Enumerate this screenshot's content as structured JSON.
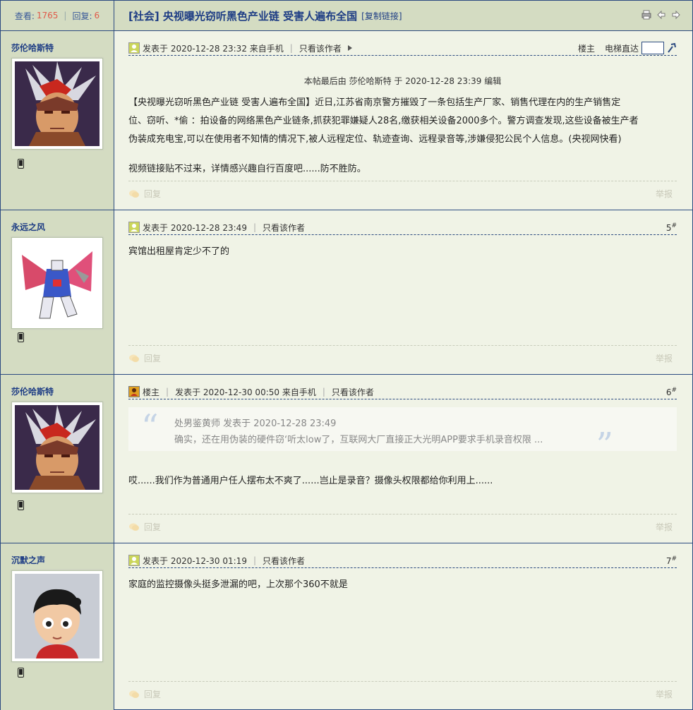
{
  "header": {
    "views_label": "查看:",
    "views": "1765",
    "replies_label": "回复:",
    "replies": "6",
    "title": "[社会] 央视曝光窃听黑色产业链 受害人遍布全国",
    "copy_link": "[复制链接]"
  },
  "common": {
    "reply": "回复",
    "report": "举报",
    "only_author": "只看该作者",
    "owner": "楼主",
    "elevator": "电梯直达"
  },
  "posts": [
    {
      "username": "莎伦哈斯特",
      "meta": "发表于 2020-12-28 23:32 来自手机",
      "edited": "本帖最后由 莎伦哈斯特 于 2020-12-28 23:39 编辑",
      "line1": "【央视曝光窃听黑色产业链 受害人遍布全国】近日,江苏省南京警方摧毁了一条包括生产厂家、销售代理在内的生产销售定",
      "line2": "位、窃听、*偷 ：拍设备的网络黑色产业链条,抓获犯罪嫌疑人28名,缴获相关设备2000多个。警方调查发现,这些设备被生产者",
      "line3": "伪装成充电宝,可以在使用者不知情的情况下,被人远程定位、轨迹查询、远程录音等,涉嫌侵犯公民个人信息。(央视网快看)",
      "line4": "视频链接贴不过来，详情感兴趣自行百度吧......防不胜防。"
    },
    {
      "username": "永远之风",
      "meta": "发表于 2020-12-28 23:49",
      "floor": "5",
      "body": "宾馆出租屋肯定少不了的"
    },
    {
      "username": "莎伦哈斯特",
      "owner_tag": "楼主",
      "meta": "发表于 2020-12-30 00:50 来自手机",
      "floor": "6",
      "quote_head": "处男鉴黄师 发表于 2020-12-28 23:49",
      "quote_text": "确实，还在用伪装的硬件窃‘听太low了，互联网大厂直接正大光明APP要求手机录音权限 ...",
      "body": "哎......我们作为普通用户任人摆布太不爽了......岂止是录音？摄像头权限都给你利用上......"
    },
    {
      "username": "沉默之声",
      "meta": "发表于 2020-12-30 01:19",
      "floor": "7",
      "body": "家庭的监控摄像头挺多泄漏的吧，上次那个360不就是"
    }
  ],
  "floor_mark": "#",
  "colors": {
    "border": "#2b4a80",
    "side_bg": "#d4dcc2",
    "main_bg": "#f0f3e6",
    "title": "#1d3c84",
    "count": "#e05a4a"
  }
}
